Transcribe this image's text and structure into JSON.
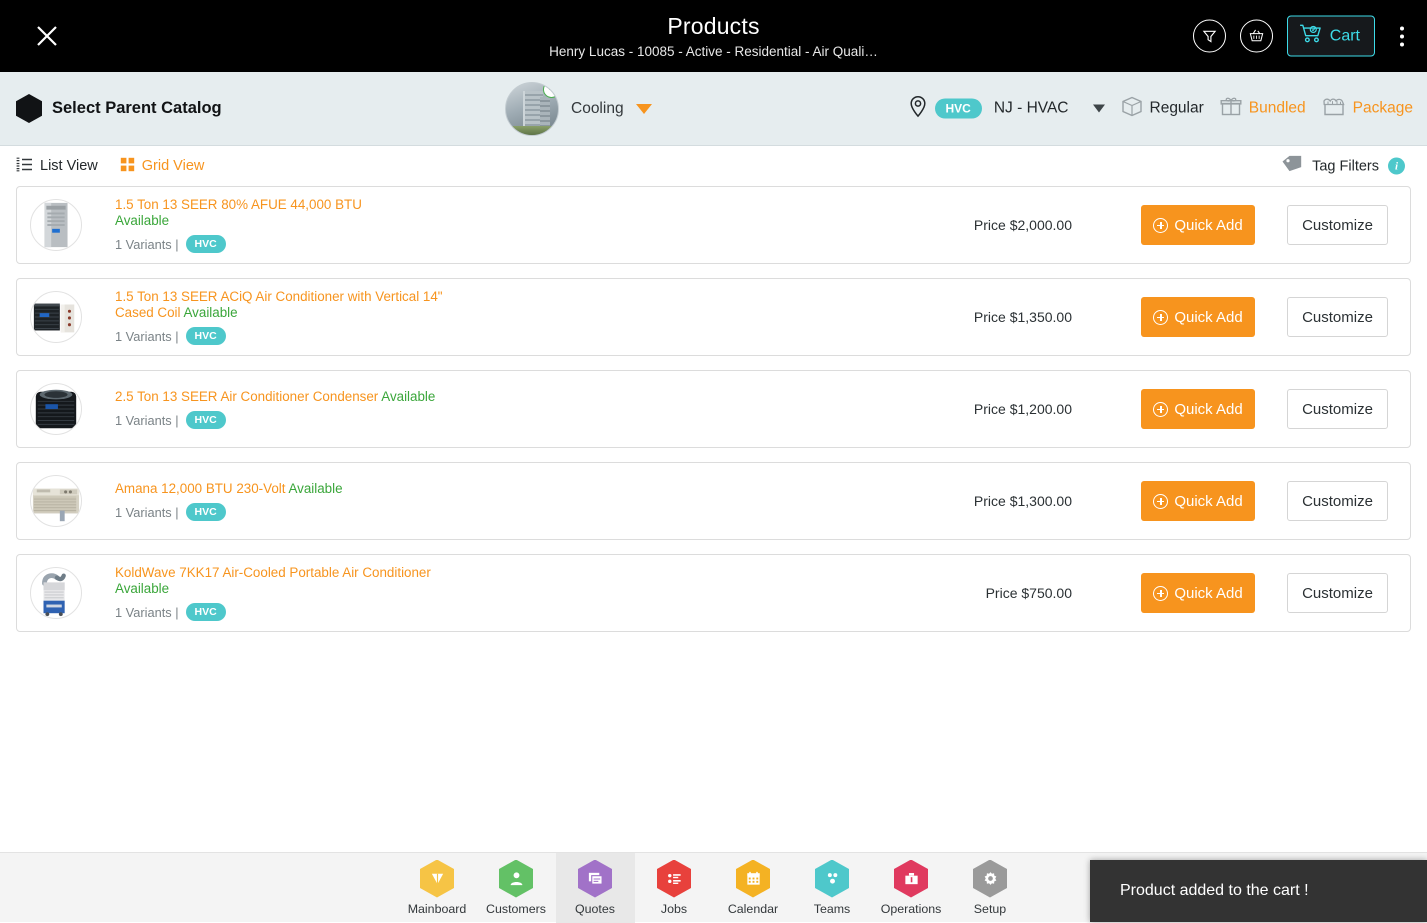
{
  "header": {
    "title": "Products",
    "subtitle": "Henry Lucas - 10085 - Active - Residential - Air Quali…",
    "close_icon": "close-icon",
    "filter_icon": "funnel-icon",
    "basket_icon": "basket-icon",
    "cart_label": "Cart",
    "cart_icon": "cart-icon",
    "menu_icon": "kebab-menu-icon",
    "accent": "#3ddbe8",
    "background": "#000000"
  },
  "toolbar": {
    "catalog_label": "Select Parent Catalog",
    "catalog_icon": "hexagon-icon",
    "entity_name": "Cooling",
    "entity_avatar": "building-avatar",
    "entity_verified_icon": "check-circle-icon",
    "dropdown_icon": "chevron-down-icon",
    "location_icon": "map-pin-icon",
    "location_badge": "HVC",
    "location_name": "NJ - HVAC",
    "location_caret": "caret-down-icon",
    "modes": [
      {
        "label": "Regular",
        "icon": "box-icon",
        "active": false,
        "color": "#23282b"
      },
      {
        "label": "Bundled",
        "icon": "gift-icon",
        "active": true,
        "color": "#f7941e"
      },
      {
        "label": "Package",
        "icon": "package-icon",
        "active": true,
        "color": "#f7941e"
      }
    ],
    "background": "#e6edef"
  },
  "viewbar": {
    "list_view_label": "List View",
    "list_view_icon": "list-icon",
    "grid_view_label": "Grid View",
    "grid_view_icon": "grid-icon",
    "tag_filters_label": "Tag Filters",
    "tag_filters_icon": "tag-icon",
    "info_icon": "info-icon",
    "info_glyph": "i"
  },
  "products": {
    "quick_add_label": "Quick Add",
    "customize_label": "Customize",
    "variants_text": "1 Variants |",
    "tag": "HVC",
    "availability": "Available",
    "accent_orange": "#f7941e",
    "available_green": "#3aa63a",
    "items": [
      {
        "name": "1.5 Ton 13 SEER 80% AFUE 44,000 BTU",
        "availability": "Available",
        "availability_inline": false,
        "variants": "1 Variants |",
        "tag": "HVC",
        "price": "Price $2,000.00",
        "thumb": "furnace-thumb"
      },
      {
        "name": "1.5 Ton 13 SEER ACiQ Air Conditioner with Vertical 14\" Cased Coil",
        "availability": "Available",
        "availability_inline": true,
        "variants": "1 Variants |",
        "tag": "HVC",
        "price": "Price $1,350.00",
        "thumb": "condenser-coil-thumb"
      },
      {
        "name": "2.5 Ton 13 SEER Air Conditioner Condenser",
        "availability": "Available",
        "availability_inline": true,
        "variants": "1 Variants |",
        "tag": "HVC",
        "price": "Price $1,200.00",
        "thumb": "condenser-thumb"
      },
      {
        "name": "Amana 12,000 BTU 230-Volt",
        "availability": "Available",
        "availability_inline": true,
        "variants": "1 Variants |",
        "tag": "HVC",
        "price": "Price $1,300.00",
        "thumb": "window-unit-thumb"
      },
      {
        "name": "KoldWave 7KK17 Air-Cooled Portable Air Conditioner",
        "availability": "Available",
        "availability_inline": true,
        "variants": "1 Variants |",
        "tag": "HVC",
        "price": "Price $750.00",
        "thumb": "portable-ac-thumb"
      }
    ]
  },
  "bottom_nav": {
    "items": [
      {
        "label": "Mainboard",
        "icon": "dashboard-icon",
        "color": "#f6c445",
        "active": false
      },
      {
        "label": "Customers",
        "icon": "person-icon",
        "color": "#63c166",
        "active": false
      },
      {
        "label": "Quotes",
        "icon": "quotes-icon",
        "color": "#a172c8",
        "active": true
      },
      {
        "label": "Jobs",
        "icon": "tasklist-icon",
        "color": "#e8413c",
        "active": false
      },
      {
        "label": "Calendar",
        "icon": "calendar-icon",
        "color": "#f4b223",
        "active": false
      },
      {
        "label": "Teams",
        "icon": "teams-icon",
        "color": "#4ec8cb",
        "active": false
      },
      {
        "label": "Operations",
        "icon": "toolbox-icon",
        "color": "#e03a5f",
        "active": false
      },
      {
        "label": "Setup",
        "icon": "gear-icon",
        "color": "#9a9a9a",
        "active": false
      }
    ]
  },
  "toast": {
    "message": "Product added to the cart !",
    "background": "#333333"
  }
}
